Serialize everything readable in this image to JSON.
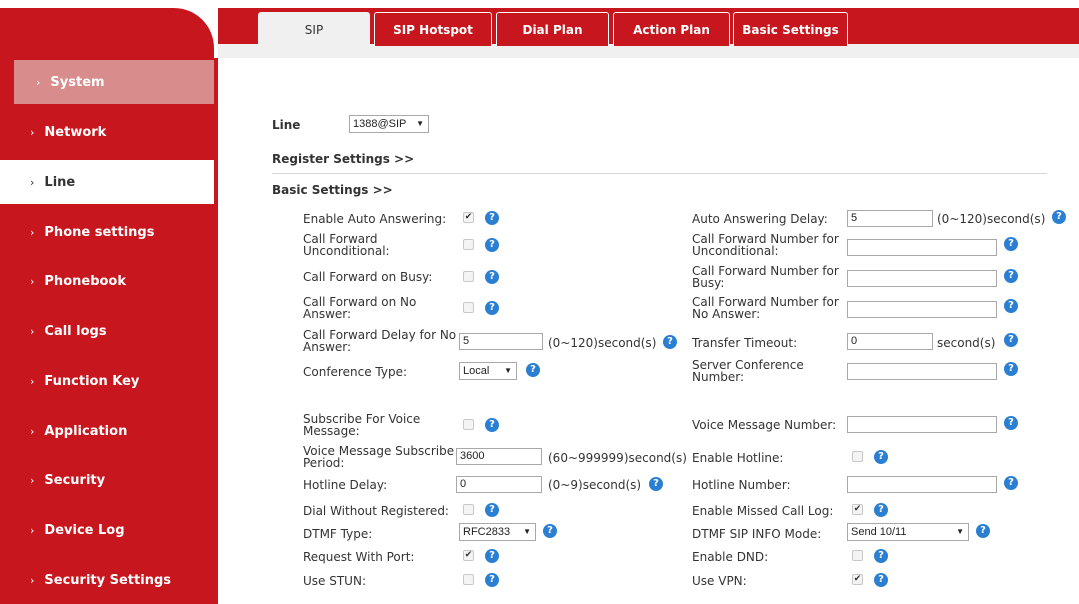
{
  "tabs": [
    "SIP",
    "SIP Hotspot",
    "Dial Plan",
    "Action Plan",
    "Basic Settings"
  ],
  "sidebar": [
    "System",
    "Network",
    "Line",
    "Phone settings",
    "Phonebook",
    "Call logs",
    "Function Key",
    "Application",
    "Security",
    "Device Log",
    "Security Settings"
  ],
  "line": {
    "label": "Line",
    "value": "1388@SIP"
  },
  "sections": {
    "register": "Register Settings >>",
    "basic": "Basic Settings >>"
  },
  "left": {
    "auto_answer": "Enable Auto Answering:",
    "cf_uncond_1": "Call Forward",
    "cf_uncond_2": "Unconditional:",
    "cf_busy": "Call Forward on Busy:",
    "cf_noans_1": "Call Forward on No",
    "cf_noans_2": "Answer:",
    "cf_delay_1": "Call Forward Delay for No",
    "cf_delay_2": "Answer:",
    "cf_delay_value": "5",
    "cf_delay_unit": "(0~120)second(s)",
    "conf_type": "Conference Type:",
    "conf_type_value": "Local",
    "sub_voice_1": "Subscribe For Voice",
    "sub_voice_2": "Message:",
    "vm_period_1": "Voice Message Subscribe",
    "vm_period_2": "Period:",
    "vm_period_value": "3600",
    "vm_period_unit": "(60~999999)second(s)",
    "hotline_delay": "Hotline Delay:",
    "hotline_delay_value": "0",
    "hotline_delay_unit": "(0~9)second(s)",
    "dial_without": "Dial Without Registered:",
    "dtmf_type": "DTMF Type:",
    "dtmf_type_value": "RFC2833",
    "req_port": "Request With Port:",
    "use_stun": "Use STUN:"
  },
  "right": {
    "aa_delay": "Auto Answering Delay:",
    "aa_delay_value": "5",
    "aa_delay_unit": "(0~120)second(s)",
    "cfn_uncond_1": "Call Forward Number for",
    "cfn_uncond_2": "Unconditional:",
    "cfn_busy_1": "Call Forward Number for",
    "cfn_busy_2": "Busy:",
    "cfn_noans_1": "Call Forward Number for",
    "cfn_noans_2": "No Answer:",
    "transfer_timeout": "Transfer Timeout:",
    "transfer_value": "0",
    "transfer_unit": "second(s)",
    "server_conf_1": "Server Conference",
    "server_conf_2": "Number:",
    "vm_number": "Voice Message Number:",
    "enable_hotline": "Enable Hotline:",
    "hotline_number": "Hotline Number:",
    "missed_log": "Enable Missed Call Log:",
    "dtmf_info": "DTMF SIP INFO Mode:",
    "dtmf_info_value": "Send 10/11",
    "enable_dnd": "Enable DND:",
    "use_vpn": "Use VPN:"
  },
  "checks": {
    "auto_answer": true,
    "cf_uncond": false,
    "cf_busy": false,
    "cf_noans": false,
    "sub_voice": false,
    "enable_hotline": false,
    "dial_without": false,
    "missed_log": true,
    "req_port": true,
    "enable_dnd": false,
    "use_stun": false,
    "use_vpn": true
  },
  "icons": {
    "help": "help-icon",
    "checkmark": "✔",
    "chevron": "›",
    "dropdown": "▼"
  }
}
